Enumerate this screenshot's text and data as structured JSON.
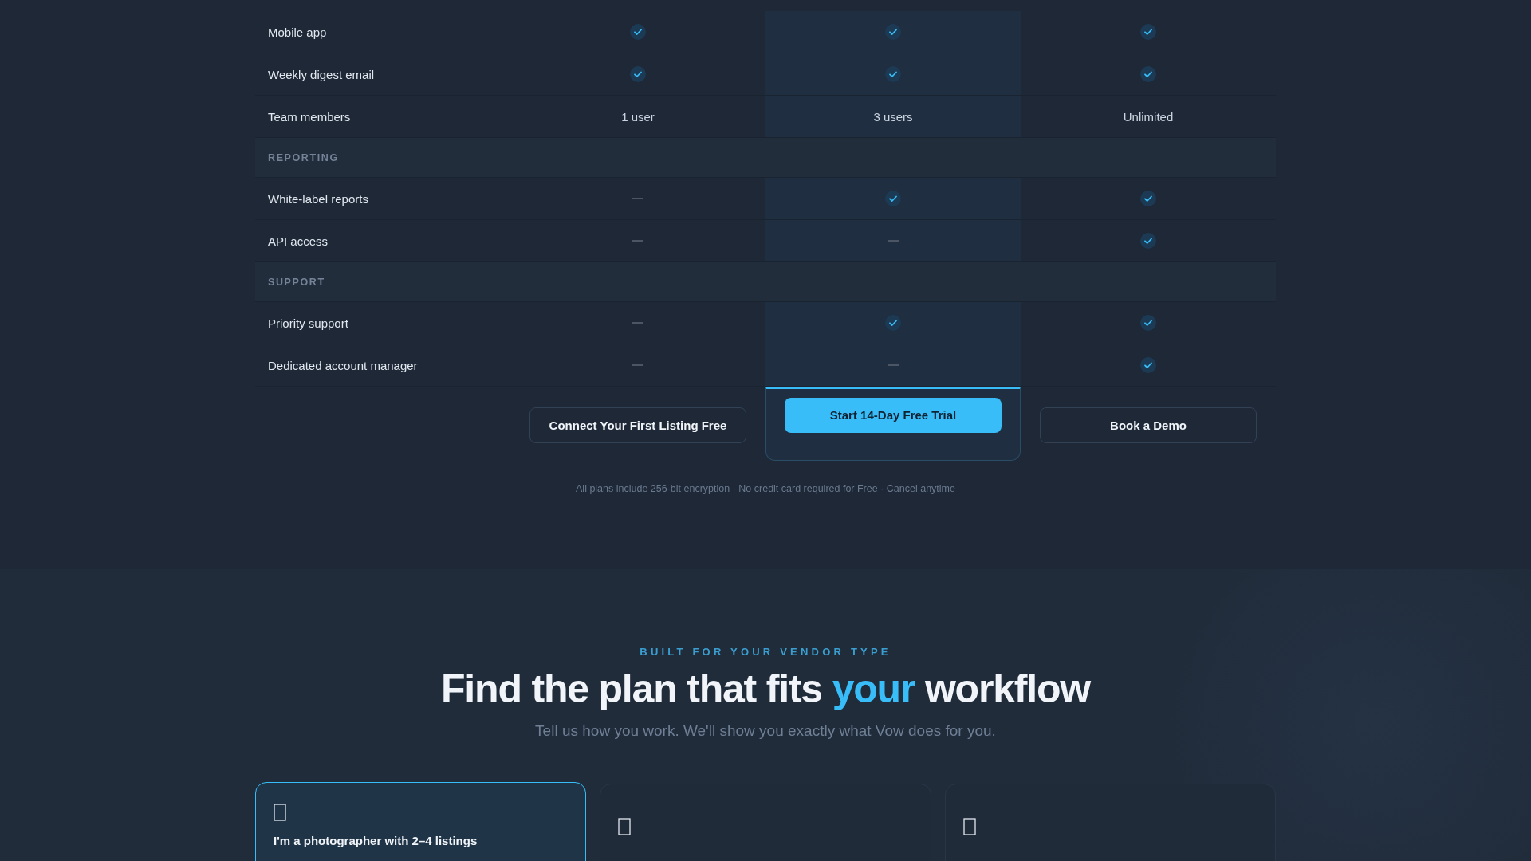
{
  "comparison": {
    "rows": [
      {
        "kind": "feature",
        "label": "Mobile app",
        "cells": [
          {
            "kind": "check"
          },
          {
            "kind": "check"
          },
          {
            "kind": "check"
          }
        ]
      },
      {
        "kind": "feature",
        "label": "Weekly digest email",
        "cells": [
          {
            "kind": "check"
          },
          {
            "kind": "check"
          },
          {
            "kind": "check"
          }
        ]
      },
      {
        "kind": "feature",
        "label": "Team members",
        "cells": [
          {
            "kind": "text",
            "text": "1 user"
          },
          {
            "kind": "text",
            "text": "3 users"
          },
          {
            "kind": "text",
            "text": "Unlimited"
          }
        ]
      },
      {
        "kind": "section",
        "label": "REPORTING"
      },
      {
        "kind": "feature",
        "label": "White-label reports",
        "cells": [
          {
            "kind": "dash"
          },
          {
            "kind": "check"
          },
          {
            "kind": "check"
          }
        ]
      },
      {
        "kind": "feature",
        "label": "API access",
        "cells": [
          {
            "kind": "dash"
          },
          {
            "kind": "dash"
          },
          {
            "kind": "check"
          }
        ]
      },
      {
        "kind": "section",
        "label": "SUPPORT"
      },
      {
        "kind": "feature",
        "label": "Priority support",
        "cells": [
          {
            "kind": "dash"
          },
          {
            "kind": "check"
          },
          {
            "kind": "check"
          }
        ]
      },
      {
        "kind": "feature",
        "label": "Dedicated account manager",
        "cells": [
          {
            "kind": "dash"
          },
          {
            "kind": "dash"
          },
          {
            "kind": "check"
          }
        ]
      }
    ],
    "plans": [
      {
        "button": "Connect Your First Listing Free",
        "featured": false
      },
      {
        "button": "Start 14-Day Free Trial",
        "featured": true
      },
      {
        "button": "Book a Demo",
        "featured": false
      }
    ],
    "footnote": "All plans include 256-bit encryption · No credit card required for Free · Cancel anytime"
  },
  "vendor_section": {
    "eyebrow": "BUILT FOR YOUR VENDOR TYPE",
    "heading": {
      "before": "Find the plan that fits ",
      "accent": "your",
      "after": " workflow"
    },
    "subtitle": "Tell us how you work. We'll show you exactly what Vow does for you.",
    "cards": [
      {
        "title": "I'm a photographer with 2–4 listings",
        "selected": true
      },
      {
        "selected": false
      },
      {
        "selected": false
      }
    ]
  }
}
